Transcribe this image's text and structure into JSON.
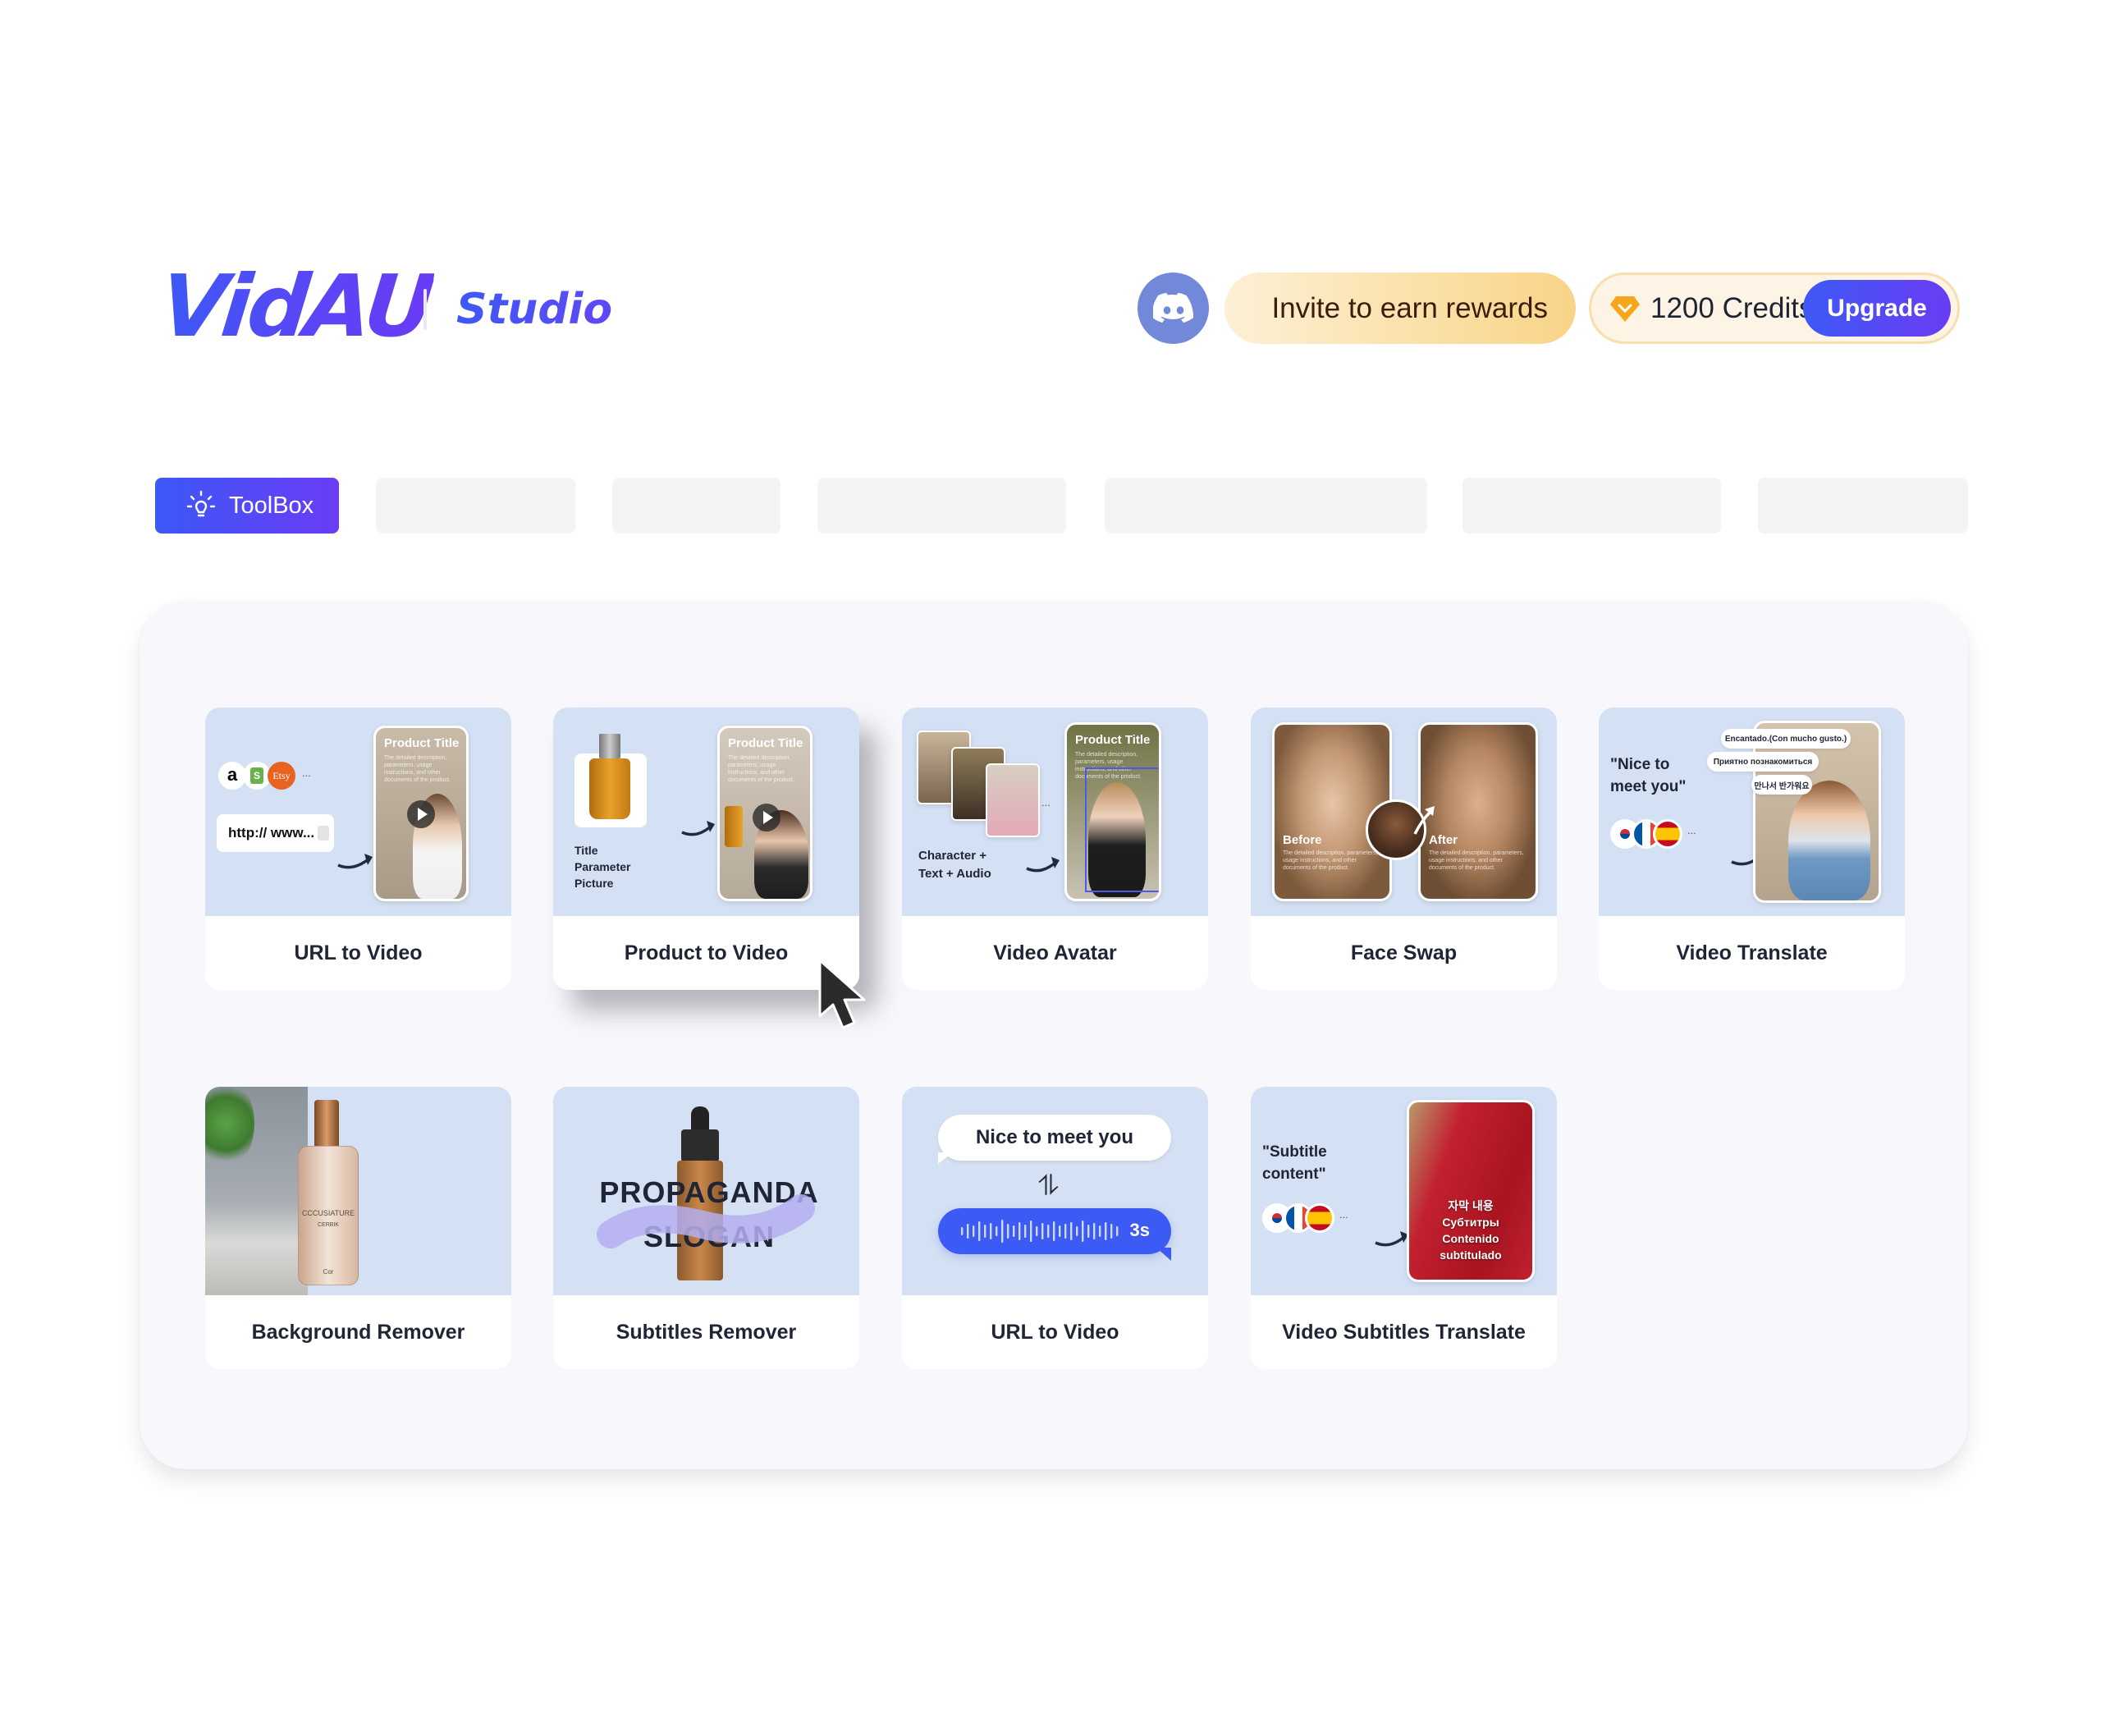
{
  "header": {
    "logo_text": "VidAU",
    "product_name": "Studio",
    "discord_icon": "discord-icon",
    "invite_label": "Invite to earn rewards",
    "credits_icon": "gem-icon",
    "credits_label": "1200 Credits",
    "upgrade_label": "Upgrade"
  },
  "tabs": [
    {
      "label": "ToolBox",
      "icon": "lightbulb-icon",
      "active": true
    },
    {
      "label": "",
      "active": false
    },
    {
      "label": "",
      "active": false
    },
    {
      "label": "",
      "active": false
    },
    {
      "label": "",
      "active": false
    },
    {
      "label": "",
      "active": false
    },
    {
      "label": "",
      "active": false
    }
  ],
  "tools": [
    {
      "label": "URL to Video",
      "thumb": {
        "platforms": [
          "a",
          "S",
          "Etsy"
        ],
        "more": "...",
        "url_text": "http:// www...",
        "phone_title": "Product Title",
        "phone_desc": "The detailed description, parameters, usage instructions, and other documents of the product."
      }
    },
    {
      "label": "Product to Video",
      "hovered": true,
      "thumb": {
        "inputs": [
          "Title",
          "Parameter",
          "Picture"
        ],
        "phone_title": "Product Title",
        "phone_desc": "The detailed description, parameters, usage instructions, and other documents of the product."
      }
    },
    {
      "label": "Video Avatar",
      "thumb": {
        "caption_line1": "Character +",
        "caption_line2": "Text + Audio",
        "more": "...",
        "phone_title": "Product Title",
        "phone_desc": "The detailed description, parameters, usage instructions, and other documents of the product."
      }
    },
    {
      "label": "Face Swap",
      "thumb": {
        "before": "Before",
        "after": "After",
        "desc": "The detailed description, parameters, usage instructions, and other documents of the product."
      }
    },
    {
      "label": "Video Translate",
      "thumb": {
        "quote_line1": "\"Nice to",
        "quote_line2": "meet you\"",
        "bubbles": [
          "Encantado.(Con mucho gusto.)",
          "Приятно познакомиться",
          "만나서 반가워요"
        ],
        "more": "..."
      }
    },
    {
      "label": "Background Remover",
      "thumb": {
        "bottle_label_1": "CCCUSIATURE",
        "bottle_label_2": "CERBIK",
        "bottle_label_3": "Cor"
      }
    },
    {
      "label": "Subtitles Remover",
      "thumb": {
        "text_line1": "PROPAGANDA",
        "text_line2": "SLOGAN"
      }
    },
    {
      "label": "URL to Video",
      "thumb": {
        "bubble_text": "Nice to meet you",
        "swap_icon": "⥮",
        "audio_duration": "3s"
      }
    },
    {
      "label": "Video Subtitles Translate",
      "thumb": {
        "quote_line1": "\"Subtitle",
        "quote_line2": "content\"",
        "more": "...",
        "subtitles": [
          "자막 내용",
          "Субтитры",
          "Contenido",
          "subtitulado"
        ]
      }
    }
  ],
  "colors": {
    "brand_gradient_start": "#3d59f5",
    "brand_gradient_end": "#6a3bf5",
    "discord": "#7289da",
    "thumb_bg": "#d4e0f3",
    "panel_bg": "#f7f7fc",
    "gem": "#f7a51c"
  }
}
